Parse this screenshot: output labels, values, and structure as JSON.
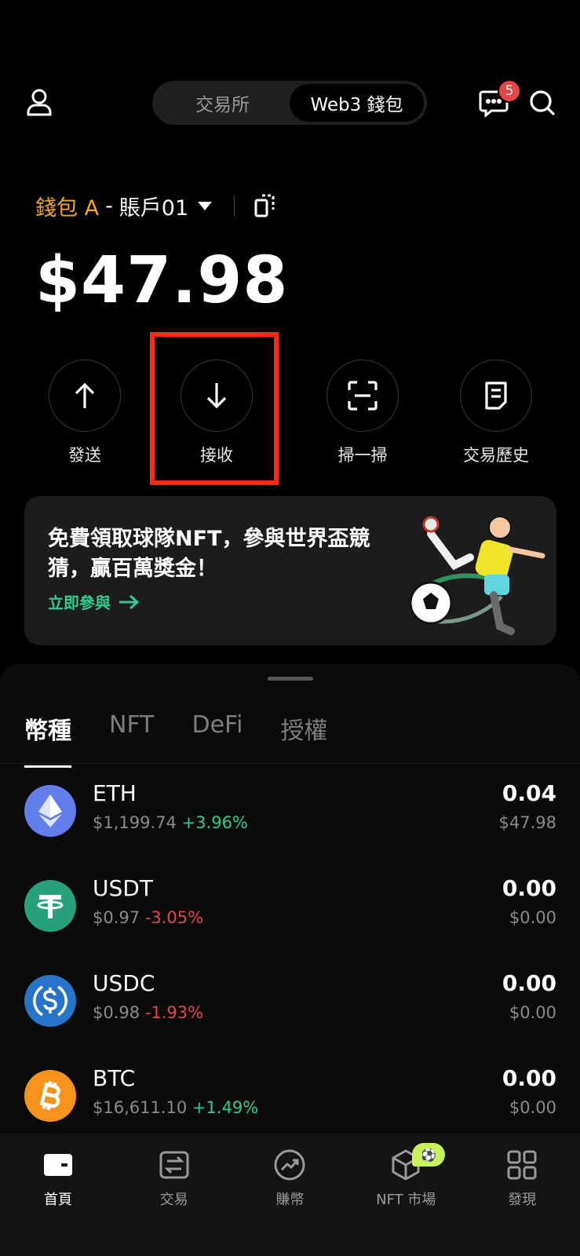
{
  "header": {
    "segments": [
      "交易所",
      "Web3 錢包"
    ],
    "active_segment": 1,
    "notification_count": "5"
  },
  "wallet": {
    "name": "錢包 A",
    "separator": "-",
    "account": "賬戶01",
    "balance": "$47.98"
  },
  "actions": [
    {
      "label": "發送",
      "icon": "arrow-up-icon"
    },
    {
      "label": "接收",
      "icon": "arrow-down-icon"
    },
    {
      "label": "掃一掃",
      "icon": "scan-icon"
    },
    {
      "label": "交易歷史",
      "icon": "document-icon"
    }
  ],
  "banner": {
    "title": "免費領取球隊NFT，參與世界盃競猜，贏百萬獎金！",
    "cta": "立即參與"
  },
  "tabs": [
    "幣種",
    "NFT",
    "DeFi",
    "授權"
  ],
  "tokens": [
    {
      "symbol": "ETH",
      "price": "$1,199.74",
      "change": "+3.96%",
      "dir": "up",
      "amount": "0.04",
      "value": "$47.98",
      "color": "#627eea"
    },
    {
      "symbol": "USDT",
      "price": "$0.97",
      "change": "-3.05%",
      "dir": "down",
      "amount": "0.00",
      "value": "$0.00",
      "color": "#26a17b"
    },
    {
      "symbol": "USDC",
      "price": "$0.98",
      "change": "-1.93%",
      "dir": "down",
      "amount": "0.00",
      "value": "$0.00",
      "color": "#2775ca"
    },
    {
      "symbol": "BTC",
      "price": "$16,611.10",
      "change": "+1.49%",
      "dir": "up",
      "amount": "0.00",
      "value": "$0.00",
      "color": "#f7931a"
    }
  ],
  "bottom_nav": [
    "首頁",
    "交易",
    "賺幣",
    "NFT 市場",
    "發現"
  ],
  "colors": {
    "accent_orange": "#f5a623",
    "up_green": "#2ecc8f",
    "down_red": "#e64545",
    "highlight_red": "#ff2a12"
  }
}
